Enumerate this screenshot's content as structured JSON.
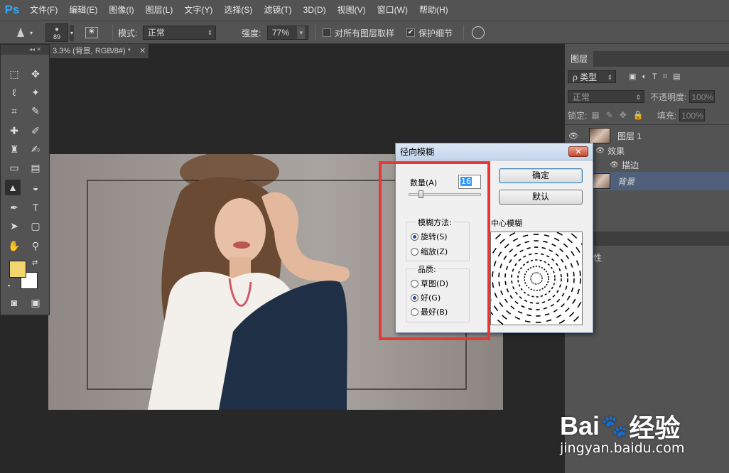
{
  "app": {
    "logo": "Ps"
  },
  "menubar": {
    "items": [
      "文件(F)",
      "编辑(E)",
      "图像(I)",
      "图层(L)",
      "文字(Y)",
      "选择(S)",
      "滤镜(T)",
      "3D(D)",
      "视图(V)",
      "窗口(W)",
      "帮助(H)"
    ]
  },
  "options": {
    "brush_size": "89",
    "mode_label": "模式:",
    "mode_value": "正常",
    "strength_label": "强度:",
    "strength_value": "77%",
    "sample_all_label": "对所有图层取样",
    "protect_detail_label": "保护细节",
    "protect_checked": "✔"
  },
  "document": {
    "tab_title": "3.3% (背景, RGB/8#) *"
  },
  "toolbox": {
    "fg_color": "#f3d46d",
    "bg_color": "#ffffff"
  },
  "layers_panel": {
    "tab": "图层",
    "filter_kind": "ρ 类型",
    "blend_mode": "正常",
    "opacity_label": "不透明度:",
    "opacity_value": "100%",
    "lock_label": "锁定:",
    "fill_label": "填充:",
    "fill_value": "100%",
    "layers": [
      {
        "name": "图层 1",
        "visible": true
      },
      {
        "name": "效果",
        "visible": true
      },
      {
        "name": "描边",
        "visible": true
      },
      {
        "name": "背景",
        "visible": true,
        "italic": true
      }
    ],
    "properties_tab": "性"
  },
  "dialog": {
    "title": "径向模糊",
    "close": "✕",
    "amount_label": "数量(A)",
    "amount_value": "16",
    "amount_fraction": 0.16,
    "method_group": "模糊方法:",
    "method_options": [
      "旋转(S)",
      "缩放(Z)"
    ],
    "method_selected": 0,
    "quality_group": "品质:",
    "quality_options": [
      "草图(D)",
      "好(G)",
      "最好(B)"
    ],
    "quality_selected": 1,
    "ok_label": "确定",
    "default_label": "默认",
    "center_label": "中心模糊"
  },
  "watermark": {
    "brand": "Bai",
    "brand2": "经验",
    "url": "jingyan.baidu.com"
  },
  "colors": {
    "highlight": "#e53935",
    "accent": "#31a8ff"
  }
}
